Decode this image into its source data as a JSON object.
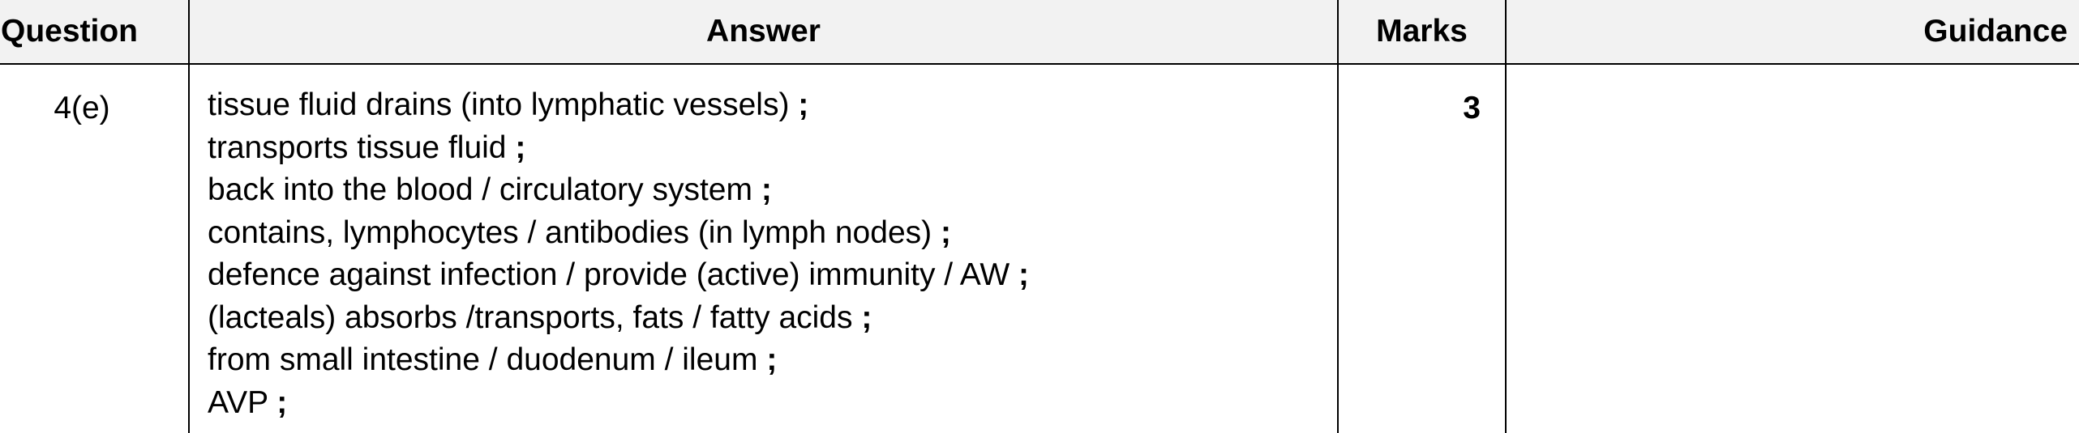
{
  "table": {
    "headers": {
      "question": "Question",
      "answer": "Answer",
      "marks": "Marks",
      "guidance": "Guidance"
    },
    "rows": [
      {
        "question": "4(e)",
        "answer_lines": [
          {
            "text": "tissue fluid drains (into lymphatic vessels)",
            "sep": ";"
          },
          {
            "text": "transports tissue fluid",
            "sep": ";"
          },
          {
            "text": "back into the blood / circulatory system",
            "sep": ";"
          },
          {
            "text": "contains, lymphocytes / antibodies (in lymph nodes)",
            "sep": ";"
          },
          {
            "text": "defence against infection / provide (active) immunity / AW",
            "sep": ";"
          },
          {
            "text": "(lacteals) absorbs /transports, fats / fatty acids",
            "sep": ";"
          },
          {
            "text": "from small intestine / duodenum / ileum",
            "sep": ";"
          },
          {
            "text": "AVP",
            "sep": ";"
          }
        ],
        "marks": "3",
        "guidance": ""
      }
    ]
  }
}
